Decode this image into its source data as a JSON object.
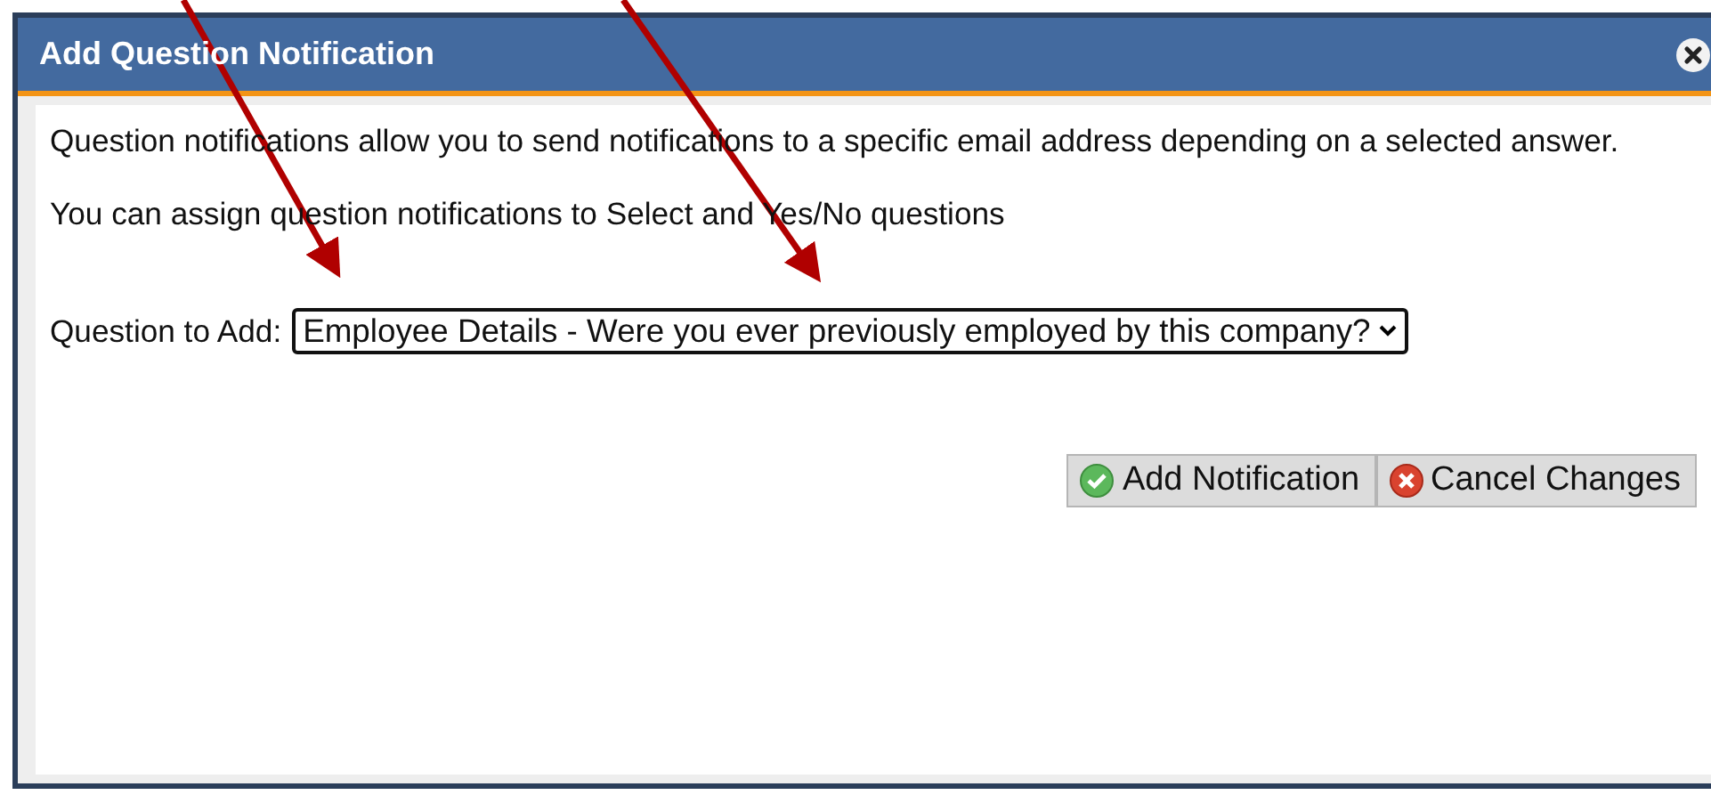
{
  "dialog": {
    "title": "Add Question Notification",
    "paragraphs": [
      "Question notifications allow you to send notifications to a specific email address depending on a selected answer.",
      "You can assign question notifications to Select and Yes/No questions"
    ],
    "question_field": {
      "label": "Question to Add:",
      "value": "Employee Details - Were you ever previously employed by this company?"
    },
    "buttons": [
      {
        "label": "Add Notification",
        "kind": "confirm"
      },
      {
        "label": "Cancel Changes",
        "kind": "cancel"
      }
    ]
  }
}
